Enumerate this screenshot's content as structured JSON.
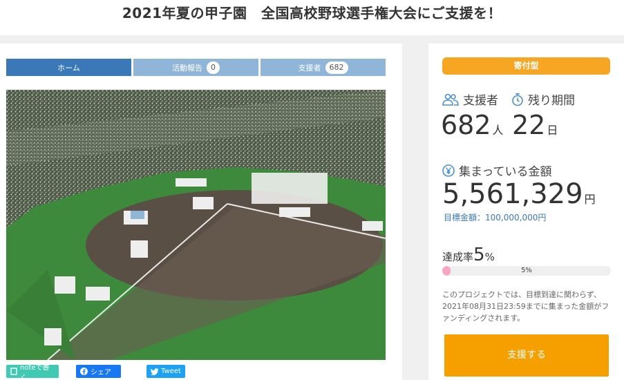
{
  "page": {
    "title": "2021年夏の甲子園　全国高校野球選手権大会にご支援を！"
  },
  "tabs": [
    {
      "label": "ホーム",
      "count": null
    },
    {
      "label": "活動報告",
      "count": "0"
    },
    {
      "label": "支援者",
      "count": "682"
    }
  ],
  "share": {
    "note": "noteで書く",
    "facebook": "シェア",
    "twitter": "Tweet"
  },
  "sidebar": {
    "type_badge": "寄付型",
    "supporters_label": "支援者",
    "supporters_value": "682",
    "supporters_unit": "人",
    "remaining_label": "残り期間",
    "remaining_value": "22",
    "remaining_unit": "日",
    "amount_label": "集まっている金額",
    "amount_value": "5,561,329",
    "amount_unit": "円",
    "goal_text": "目標金額：100,000,000円",
    "rate_label": "達成率",
    "rate_value": "5",
    "rate_unit": "%",
    "progress_percent": 5,
    "progress_text": "5%",
    "notice": "このプロジェクトでは、目標到達に関わらず、2021年08月31日23:59までに集まった金額がファンディングされます。",
    "support_button": "支援する"
  },
  "colors": {
    "tab_active": "#3a78b7",
    "tab_inactive": "#8fb5d9",
    "badge": "#f6a623",
    "button": "#f6a000",
    "progress_fill": "#f7a6c6",
    "icon_blue": "#4a8fd0"
  }
}
